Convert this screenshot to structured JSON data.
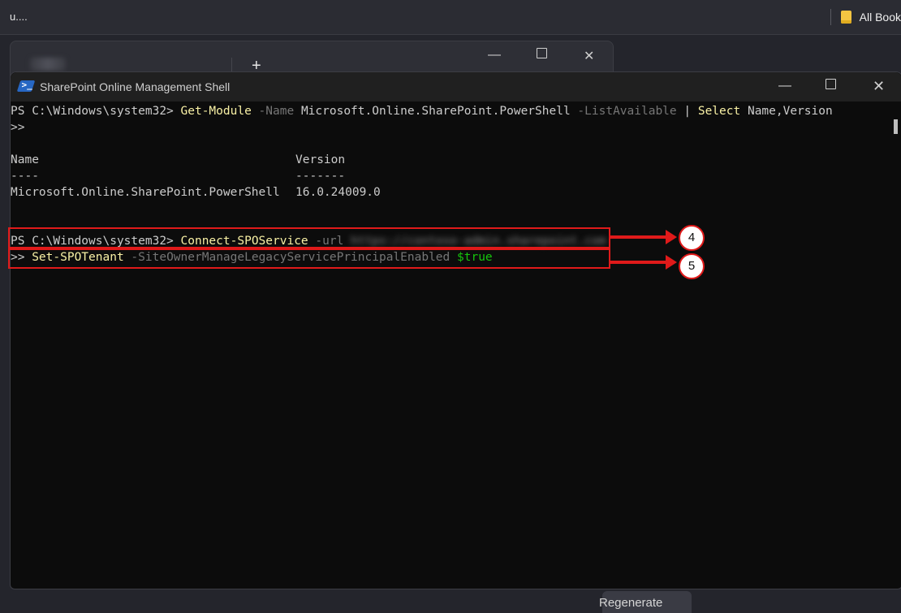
{
  "browser": {
    "left_text": "u....",
    "bookmarks_label": "All Book"
  },
  "bg_window": {
    "new_tab": "+",
    "minimize": "—",
    "close": "✕"
  },
  "shell": {
    "title": "SharePoint Online Management Shell",
    "minimize": "—",
    "close": "✕",
    "lines": {
      "l1": {
        "prompt": "PS C:\\Windows\\system32> ",
        "cmd": "Get-Module",
        "p1": " -Name",
        "a1": " Microsoft.Online.SharePoint.PowerShell",
        "p2": " -ListAvailable",
        "pipe": " | ",
        "cmd2": "Select",
        "a2": " Name,Version"
      },
      "l2": ">>",
      "header_name": "Name",
      "header_version": "Version",
      "dash_name": "----",
      "dash_version": "-------",
      "row_name": "Microsoft.Online.SharePoint.PowerShell",
      "row_version": "16.0.24009.0",
      "l_connect": {
        "prompt": "PS C:\\Windows\\system32> ",
        "cmd": "Connect-SPOService",
        "param": " -url",
        "blurred": " https://contoso-admin.sharepoint.com"
      },
      "l_set": {
        "prompt": ">> ",
        "cmd": "Set-SPOTenant",
        "param": " -SiteOwnerManageLegacyServicePrincipalEnabled",
        "value": " $true"
      }
    }
  },
  "annotations": {
    "step4": "4",
    "step5": "5",
    "accent": "#e01a1a"
  },
  "footer": {
    "regenerate": "Regenerate"
  }
}
